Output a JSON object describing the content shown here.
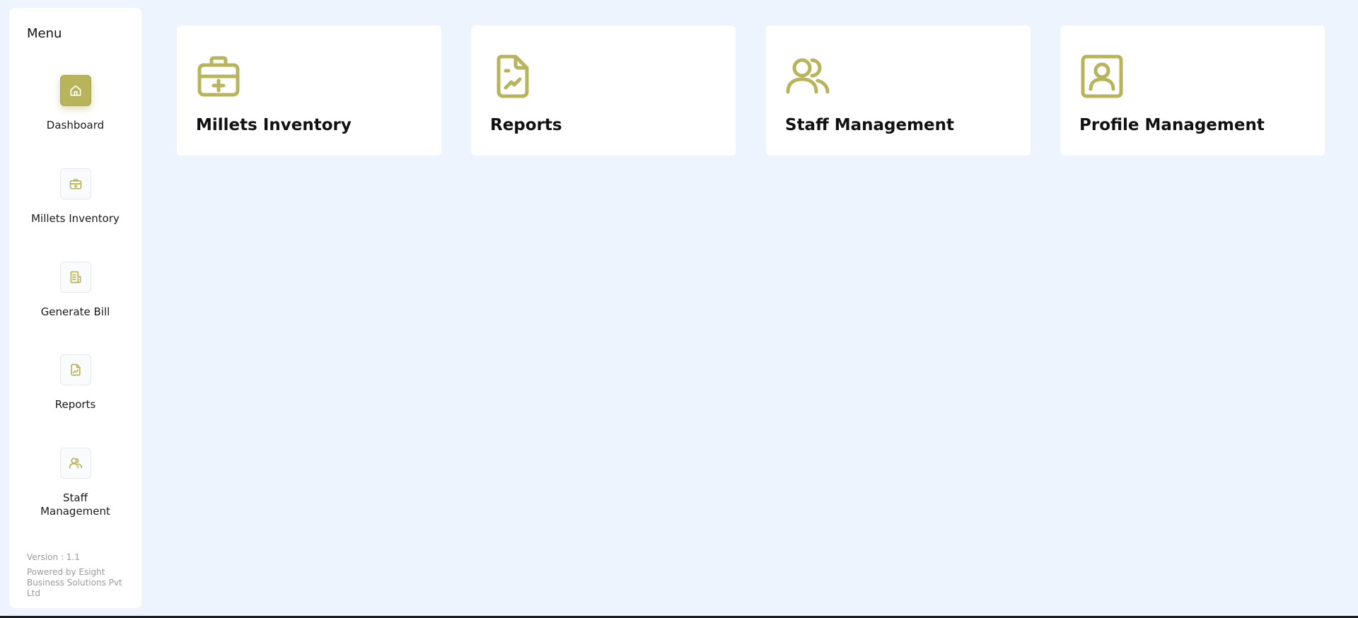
{
  "sidebar": {
    "menu_title": "Menu",
    "items": [
      {
        "label": "Dashboard",
        "icon": "home-icon",
        "active": true
      },
      {
        "label": "Millets Inventory",
        "icon": "medkit-icon",
        "active": false
      },
      {
        "label": "Generate Bill",
        "icon": "bill-icon",
        "active": false
      },
      {
        "label": "Reports",
        "icon": "report-icon",
        "active": false
      },
      {
        "label": "Staff Management",
        "icon": "users-icon",
        "active": false
      }
    ],
    "version": "Version : 1.1",
    "powered_by": "Powered by Esight Business Solutions Pvt Ltd"
  },
  "cards": [
    {
      "title": "Millets Inventory",
      "icon": "medkit-icon"
    },
    {
      "title": "Reports",
      "icon": "report-icon"
    },
    {
      "title": "Staff Management",
      "icon": "users-icon"
    },
    {
      "title": "Profile Management",
      "icon": "profile-icon"
    }
  ],
  "colors": {
    "accent": "#b8b45c",
    "background": "#eef4fd",
    "card": "#ffffff"
  }
}
